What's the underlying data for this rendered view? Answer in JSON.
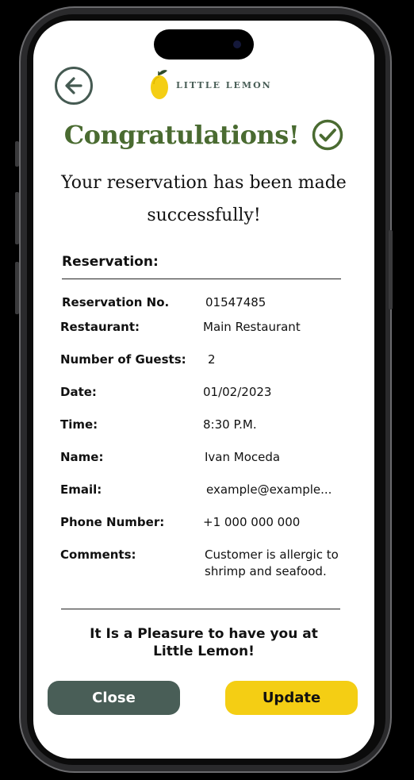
{
  "header": {
    "back_icon": "arrow-left-circle-icon",
    "logo_icon": "lemon-icon",
    "logo_text": "LITTLE LEMON"
  },
  "title": "Congratulations!",
  "title_icon": "check-circle-icon",
  "subtitle": "Your reservation has been made successfully!",
  "section_label": "Reservation:",
  "details": {
    "reservation_no": {
      "label": "Reservation No.",
      "value": "01547485"
    },
    "restaurant": {
      "label": "Restaurant:",
      "value": "Main Restaurant"
    },
    "guests": {
      "label": "Number of Guests:",
      "value": "2"
    },
    "date": {
      "label": "Date:",
      "value": "01/02/2023"
    },
    "time": {
      "label": "Time:",
      "value": "8:30 P.M."
    },
    "name": {
      "label": "Name:",
      "value": "Ivan Moceda"
    },
    "email": {
      "label": "Email:",
      "value": "example@example..."
    },
    "phone": {
      "label": "Phone Number:",
      "value": "+1 000 000 000"
    },
    "comments": {
      "label": "Comments:",
      "value_line1": "Customer is allergic to",
      "value_line2": "shrimp and seafood."
    }
  },
  "closing_line1": "It Is a Pleasure to have you at",
  "closing_line2": "Little Lemon!",
  "buttons": {
    "close": "Close",
    "update": "Update"
  },
  "colors": {
    "brand_green": "#495e57",
    "title_green": "#4a6b31",
    "brand_yellow": "#f4ce14"
  }
}
